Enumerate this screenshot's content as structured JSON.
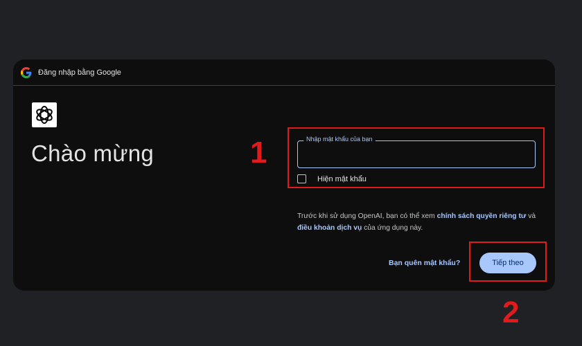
{
  "dialog": {
    "header_title": "Đăng nhập bằng Google",
    "welcome_heading": "Chào mừng",
    "password_field_label": "Nhập mật khẩu của bạn",
    "password_value": "",
    "show_password_label": "Hiện mật khẩu",
    "show_password_checked": false,
    "policy": {
      "prefix": "Trước khi sử dụng OpenAI, bạn có thể xem ",
      "privacy_link": "chính sách quyền riêng tư",
      "conjunction": " và ",
      "terms_link": "điều khoản dịch vụ",
      "suffix": " của ứng dụng này."
    },
    "forgot_password": "Bạn quên mật khẩu?",
    "next_button": "Tiếp theo"
  },
  "annotations": {
    "step1": "1",
    "step2": "2",
    "highlight_color": "#e11b1b"
  },
  "icons": {
    "header": "google-g-icon",
    "app": "openai-logo-icon"
  }
}
